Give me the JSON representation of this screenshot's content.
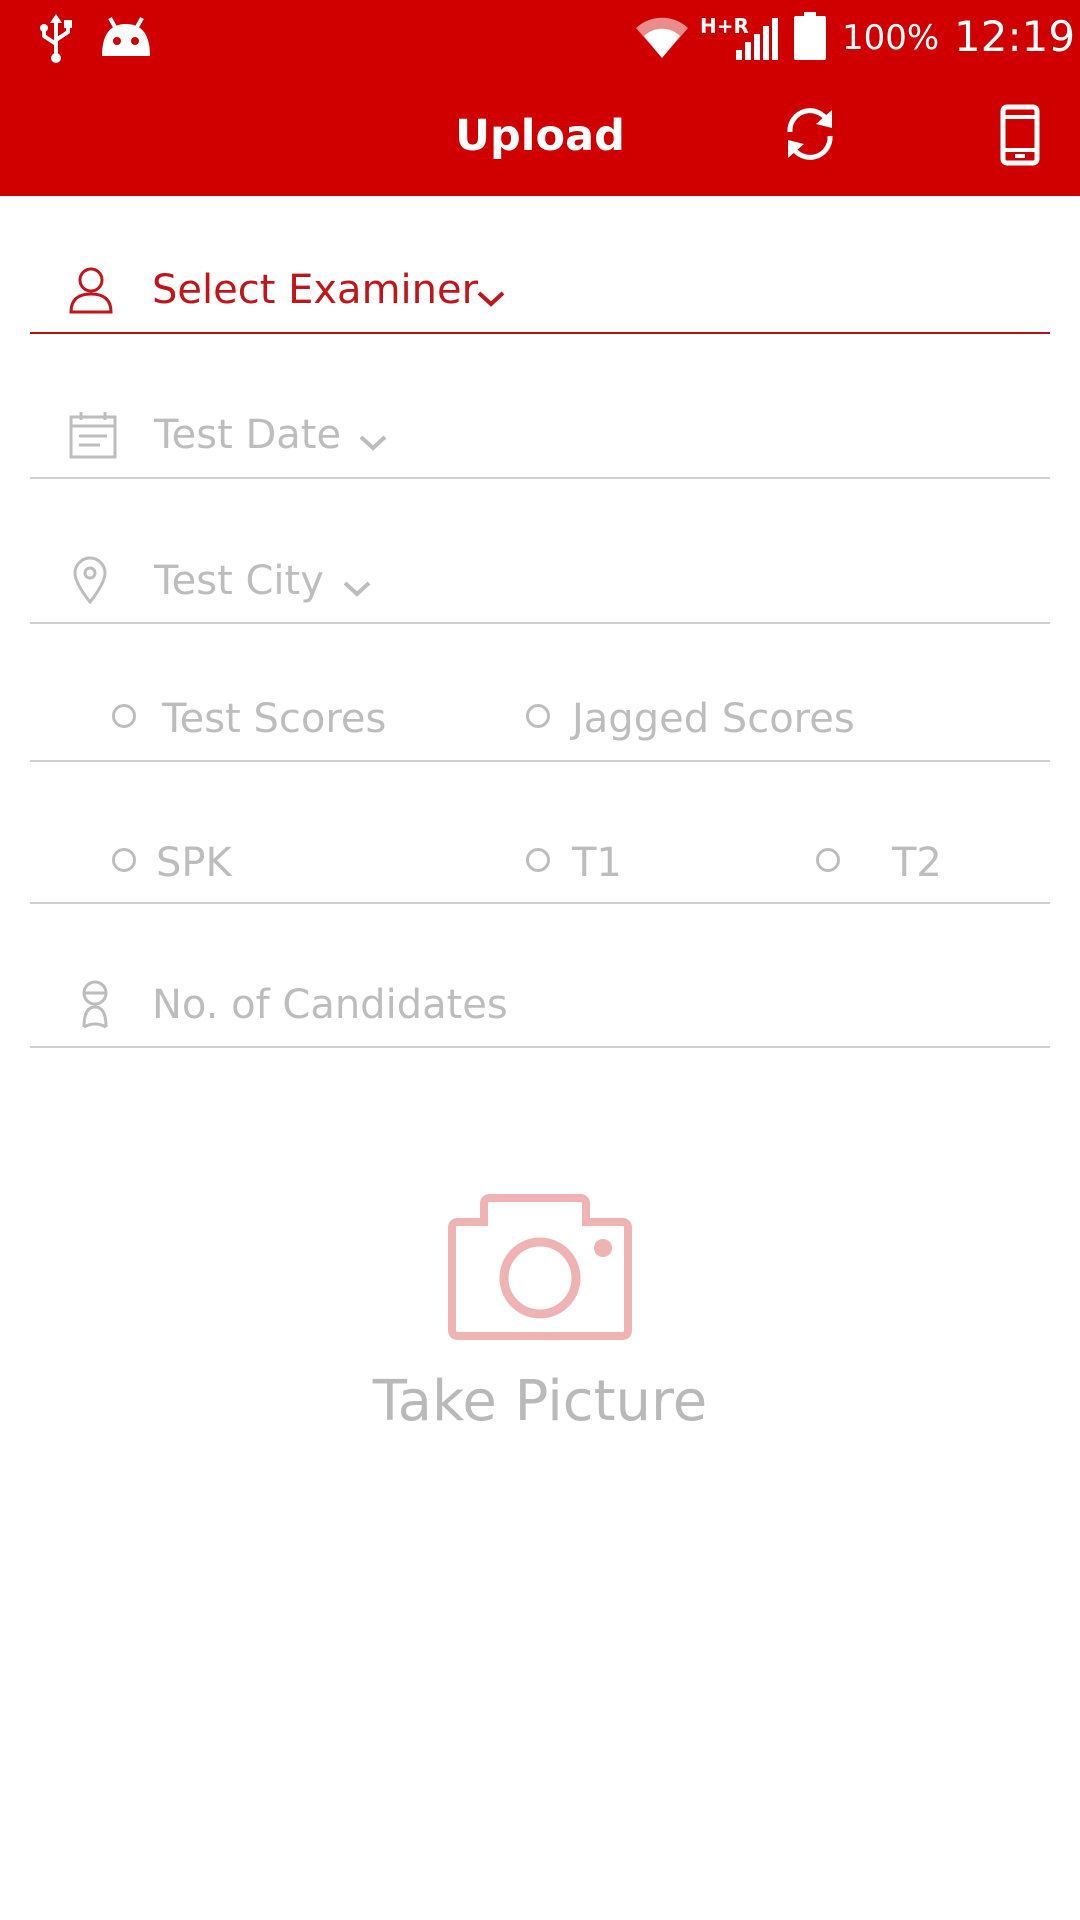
{
  "status_bar": {
    "network_label": "H+R",
    "battery_percent": "100%",
    "time": "12:19"
  },
  "toolbar": {
    "title": "Upload"
  },
  "form": {
    "examiner_placeholder": "Select Examiner",
    "test_date_placeholder": "Test Date",
    "test_city_placeholder": "Test City",
    "score_type_options": [
      "Test Scores",
      "Jagged Scores"
    ],
    "module_options": [
      "SPK",
      "T1",
      "T2"
    ],
    "candidates_placeholder": "No. of Candidates"
  },
  "camera": {
    "label": "Take Picture"
  },
  "colors": {
    "primary": "#d10000",
    "active_text": "#c0151a",
    "hint_text": "#bdbdbd",
    "camera_icon": "#f0b3b3"
  },
  "icons": {
    "usb": "usb-icon",
    "android": "android-icon",
    "wifi": "wifi-icon",
    "signal": "signal-icon",
    "battery": "battery-icon",
    "sync": "sync-icon",
    "device": "phone-icon",
    "person": "person-icon",
    "calendar": "calendar-icon",
    "location": "location-pin-icon",
    "candidate": "candidate-icon",
    "camera": "camera-icon",
    "chevron": "chevron-down-icon"
  }
}
